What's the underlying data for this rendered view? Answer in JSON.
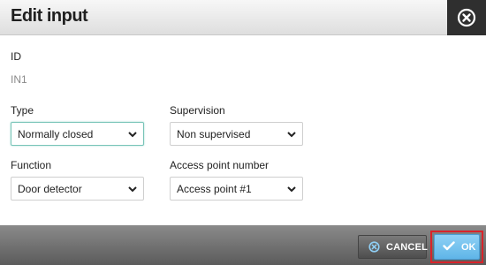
{
  "dialog": {
    "title": "Edit input",
    "close_icon": "close-circle-icon"
  },
  "fields": {
    "id": {
      "label": "ID",
      "value": "IN1"
    },
    "type": {
      "label": "Type",
      "value": "Normally closed"
    },
    "supervision": {
      "label": "Supervision",
      "value": "Non supervised"
    },
    "function": {
      "label": "Function",
      "value": "Door detector"
    },
    "access_point": {
      "label": "Access point number",
      "value": "Access point #1"
    }
  },
  "footer": {
    "cancel_label": "CANCEL",
    "ok_label": "OK"
  },
  "colors": {
    "ok_button": "#6bbbed",
    "highlight": "#d9232a",
    "focus_border": "#78c4b8"
  }
}
